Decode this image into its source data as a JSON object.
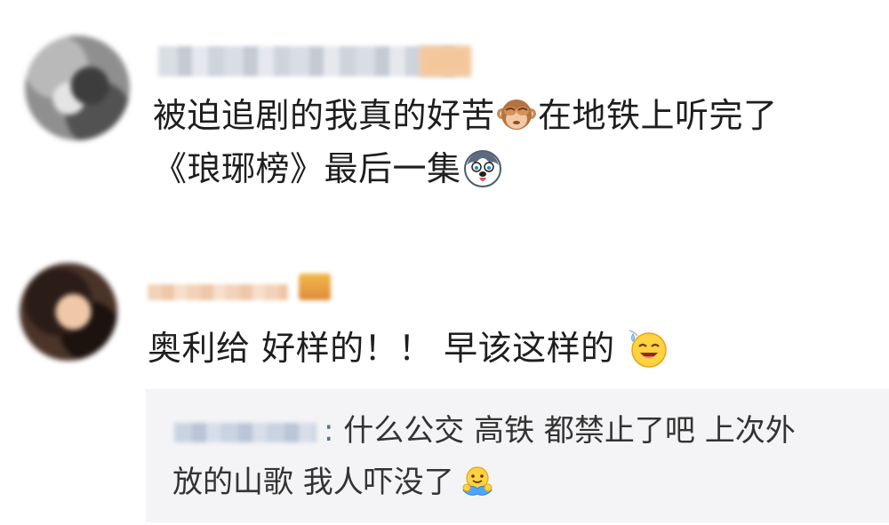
{
  "comments": [
    {
      "lines": [
        "被迫追剧的我真的好苦",
        "在地铁上听完了",
        "《琅琊榜》最后一集"
      ],
      "emojis": [
        "see-no-evil-monkey",
        "husky-dog"
      ]
    },
    {
      "text": "奥利给 好样的！！ 早该这样的",
      "emojis": [
        "sweat-smile-face"
      ],
      "reply": {
        "colon": ":",
        "line1": "什么公交 高铁 都禁止了吧 上次外",
        "line2": "放的山歌 我人吓没了",
        "emojis": [
          "hugging-face"
        ]
      }
    }
  ],
  "colors": {
    "background": "#ffffff",
    "text": "#1e1e1e",
    "reply_background": "#f4f4f6",
    "reply_name": "#5a6f92"
  }
}
